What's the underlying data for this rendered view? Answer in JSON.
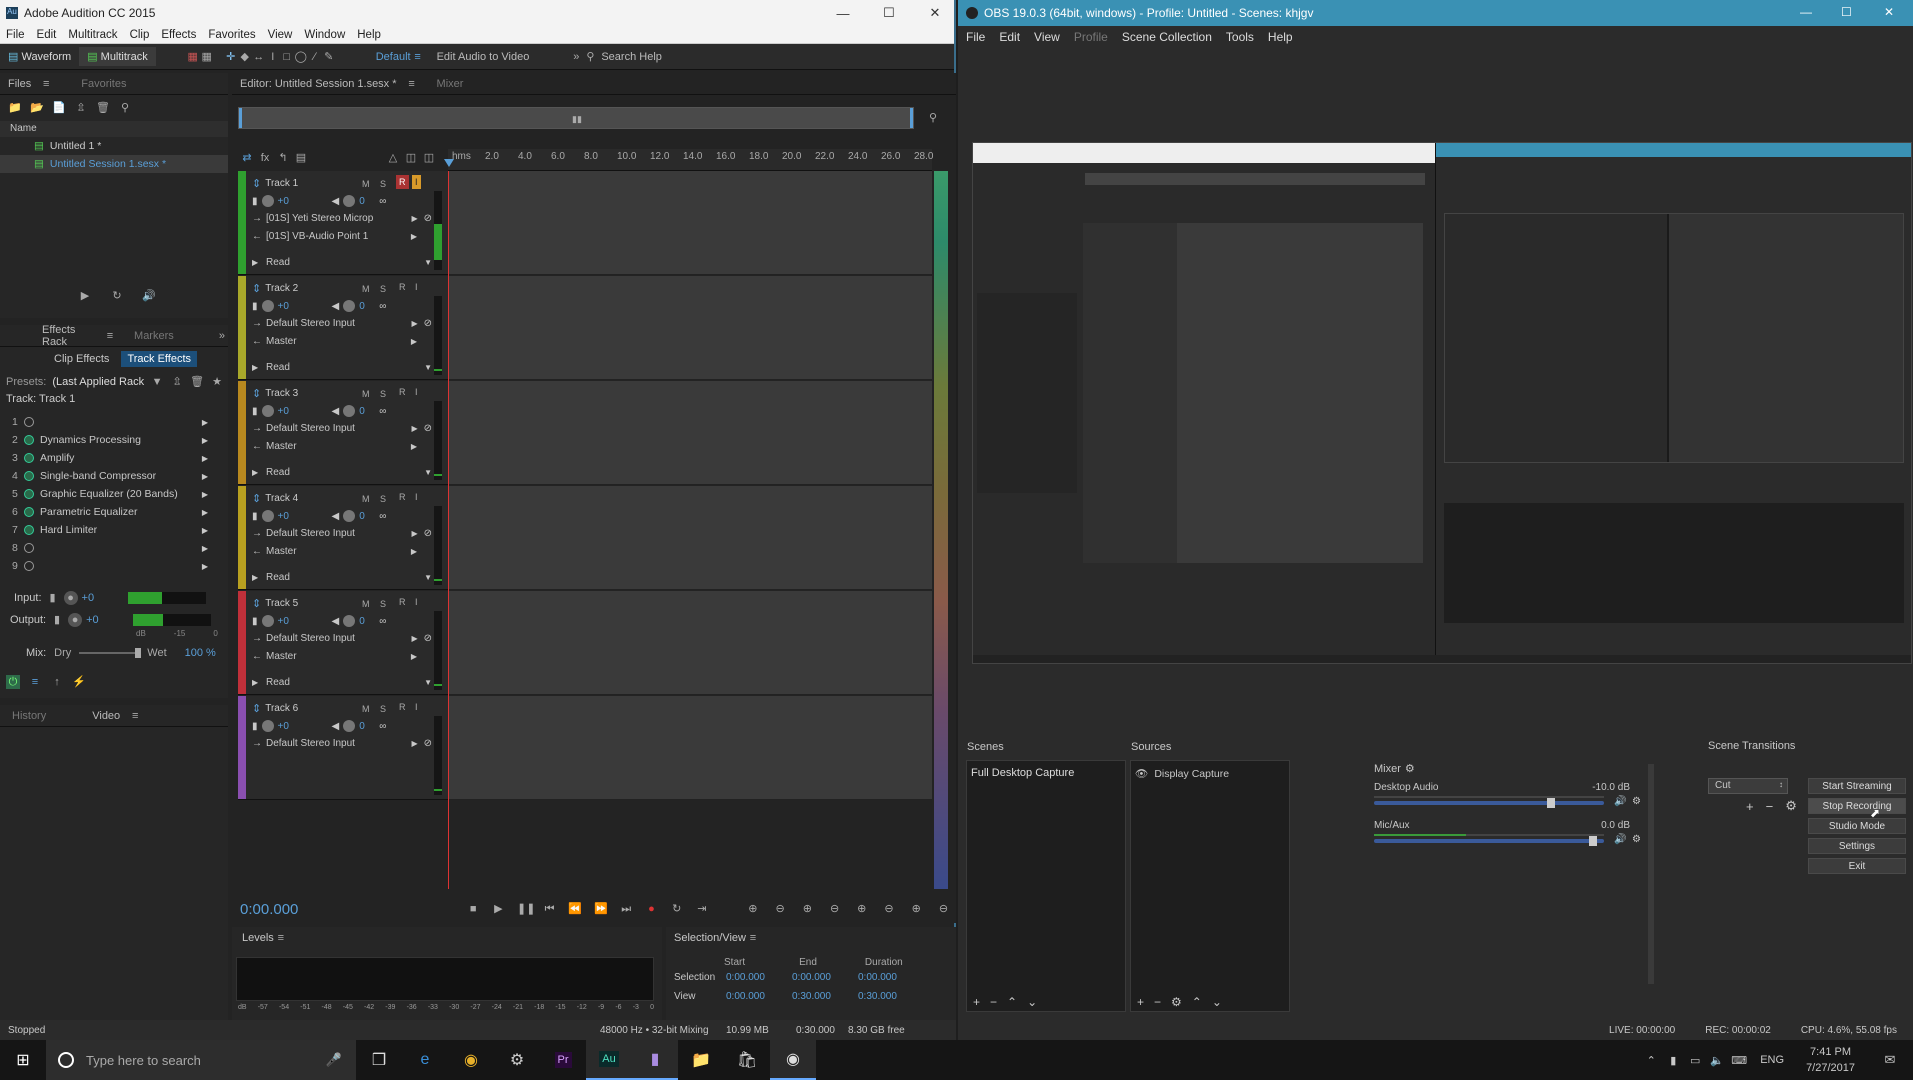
{
  "audition": {
    "title": "Adobe Audition CC 2015",
    "menu": [
      "File",
      "Edit",
      "Multitrack",
      "Clip",
      "Effects",
      "Favorites",
      "View",
      "Window",
      "Help"
    ],
    "toolbar": {
      "waveform": "Waveform",
      "multitrack": "Multitrack",
      "workspace": "Default",
      "edit_audio_video": "Edit Audio to Video",
      "search_help": "Search Help"
    },
    "files_panel": {
      "tabs": [
        "Files",
        "Favorites"
      ],
      "header": "Name",
      "items": [
        "Untitled 1 *",
        "Untitled Session 1.sesx *"
      ]
    },
    "effects_rack": {
      "tabs": [
        "Effects Rack",
        "Markers"
      ],
      "subtabs": [
        "Clip Effects",
        "Track Effects"
      ],
      "presets_label": "Presets:",
      "presets_value": "(Last Applied Rack",
      "track_label": "Track: Track 1",
      "effects": [
        {
          "n": "1",
          "name": ""
        },
        {
          "n": "2",
          "name": "Dynamics Processing"
        },
        {
          "n": "3",
          "name": "Amplify"
        },
        {
          "n": "4",
          "name": "Single-band Compressor"
        },
        {
          "n": "5",
          "name": "Graphic Equalizer (20 Bands)"
        },
        {
          "n": "6",
          "name": "Parametric Equalizer"
        },
        {
          "n": "7",
          "name": "Hard Limiter"
        },
        {
          "n": "8",
          "name": ""
        },
        {
          "n": "9",
          "name": ""
        }
      ],
      "input_label": "Input:",
      "input_val": "+0",
      "output_label": "Output:",
      "output_val": "+0",
      "meter_scale": [
        "dB",
        "-15",
        "0"
      ],
      "mix_label": "Mix:",
      "dry": "Dry",
      "wet": "Wet",
      "wet_pct": "100 %"
    },
    "bottom_tabs": [
      "History",
      "Video"
    ],
    "editor": {
      "tab": "Editor: Untitled Session 1.sesx *",
      "mixer": "Mixer",
      "ruler": [
        "hms",
        "2.0",
        "4.0",
        "6.0",
        "8.0",
        "10.0",
        "12.0",
        "14.0",
        "16.0",
        "18.0",
        "20.0",
        "22.0",
        "24.0",
        "26.0",
        "28.0"
      ],
      "tracks": [
        {
          "name": "Track 1",
          "vol": "+0",
          "pan": "0",
          "input": "[01S] Yeti Stereo Microp",
          "output": "[01S] VB-Audio Point 1",
          "mode": "Read",
          "color": "#2fa02f"
        },
        {
          "name": "Track 2",
          "vol": "+0",
          "pan": "0",
          "input": "Default Stereo Input",
          "output": "Master",
          "mode": "Read",
          "color": "#a8a82a"
        },
        {
          "name": "Track 3",
          "vol": "+0",
          "pan": "0",
          "input": "Default Stereo Input",
          "output": "Master",
          "mode": "Read",
          "color": "#b8891f"
        },
        {
          "name": "Track 4",
          "vol": "+0",
          "pan": "0",
          "input": "Default Stereo Input",
          "output": "Master",
          "mode": "Read",
          "color": "#b8a020"
        },
        {
          "name": "Track 5",
          "vol": "+0",
          "pan": "0",
          "input": "Default Stereo Input",
          "output": "Master",
          "mode": "Read",
          "color": "#c0303a"
        },
        {
          "name": "Track 6",
          "vol": "+0",
          "pan": "0",
          "input": "Default Stereo Input",
          "output": "",
          "mode": "",
          "color": "#8a4fb0"
        }
      ],
      "time": "0:00.000"
    },
    "levels": {
      "title": "Levels",
      "scale": [
        "dB",
        "-57",
        "-54",
        "-51",
        "-48",
        "-45",
        "-42",
        "-39",
        "-36",
        "-33",
        "-30",
        "-27",
        "-24",
        "-21",
        "-18",
        "-15",
        "-12",
        "-9",
        "-6",
        "-3",
        "0"
      ]
    },
    "selection": {
      "title": "Selection/View",
      "cols": [
        "Start",
        "End",
        "Duration"
      ],
      "selection_label": "Selection",
      "view_label": "View",
      "sel": [
        "0:00.000",
        "0:00.000",
        "0:00.000"
      ],
      "view": [
        "0:00.000",
        "0:30.000",
        "0:30.000"
      ]
    },
    "status": {
      "left": "Stopped",
      "sample": "48000 Hz • 32-bit Mixing",
      "size": "10.99 MB",
      "dur": "0:30.000",
      "free": "8.30 GB free"
    }
  },
  "obs": {
    "title": "OBS 19.0.3 (64bit, windows) - Profile: Untitled - Scenes: khjgv",
    "menu": [
      "File",
      "Edit",
      "View",
      "Profile",
      "Scene Collection",
      "Tools",
      "Help"
    ],
    "scenes": {
      "title": "Scenes",
      "items": [
        "Full Desktop Capture"
      ]
    },
    "sources": {
      "title": "Sources",
      "items": [
        "Display Capture"
      ]
    },
    "mixer": {
      "title": "Mixer",
      "channels": [
        {
          "name": "Desktop Audio",
          "db": "-10.0 dB",
          "level": 0.77
        },
        {
          "name": "Mic/Aux",
          "db": "0.0 dB",
          "level": 0.95
        }
      ]
    },
    "transitions": {
      "title": "Scene Transitions",
      "value": "Cut"
    },
    "buttons": [
      "Start Streaming",
      "Stop Recording",
      "Studio Mode",
      "Settings",
      "Exit"
    ],
    "status": {
      "live": "LIVE: 00:00:00",
      "rec": "REC: 00:00:02",
      "cpu": "CPU: 4.6%, 55.08 fps"
    }
  },
  "taskbar": {
    "search": "Type here to search",
    "lang": "ENG",
    "time": "7:41 PM",
    "date": "7/27/2017"
  }
}
